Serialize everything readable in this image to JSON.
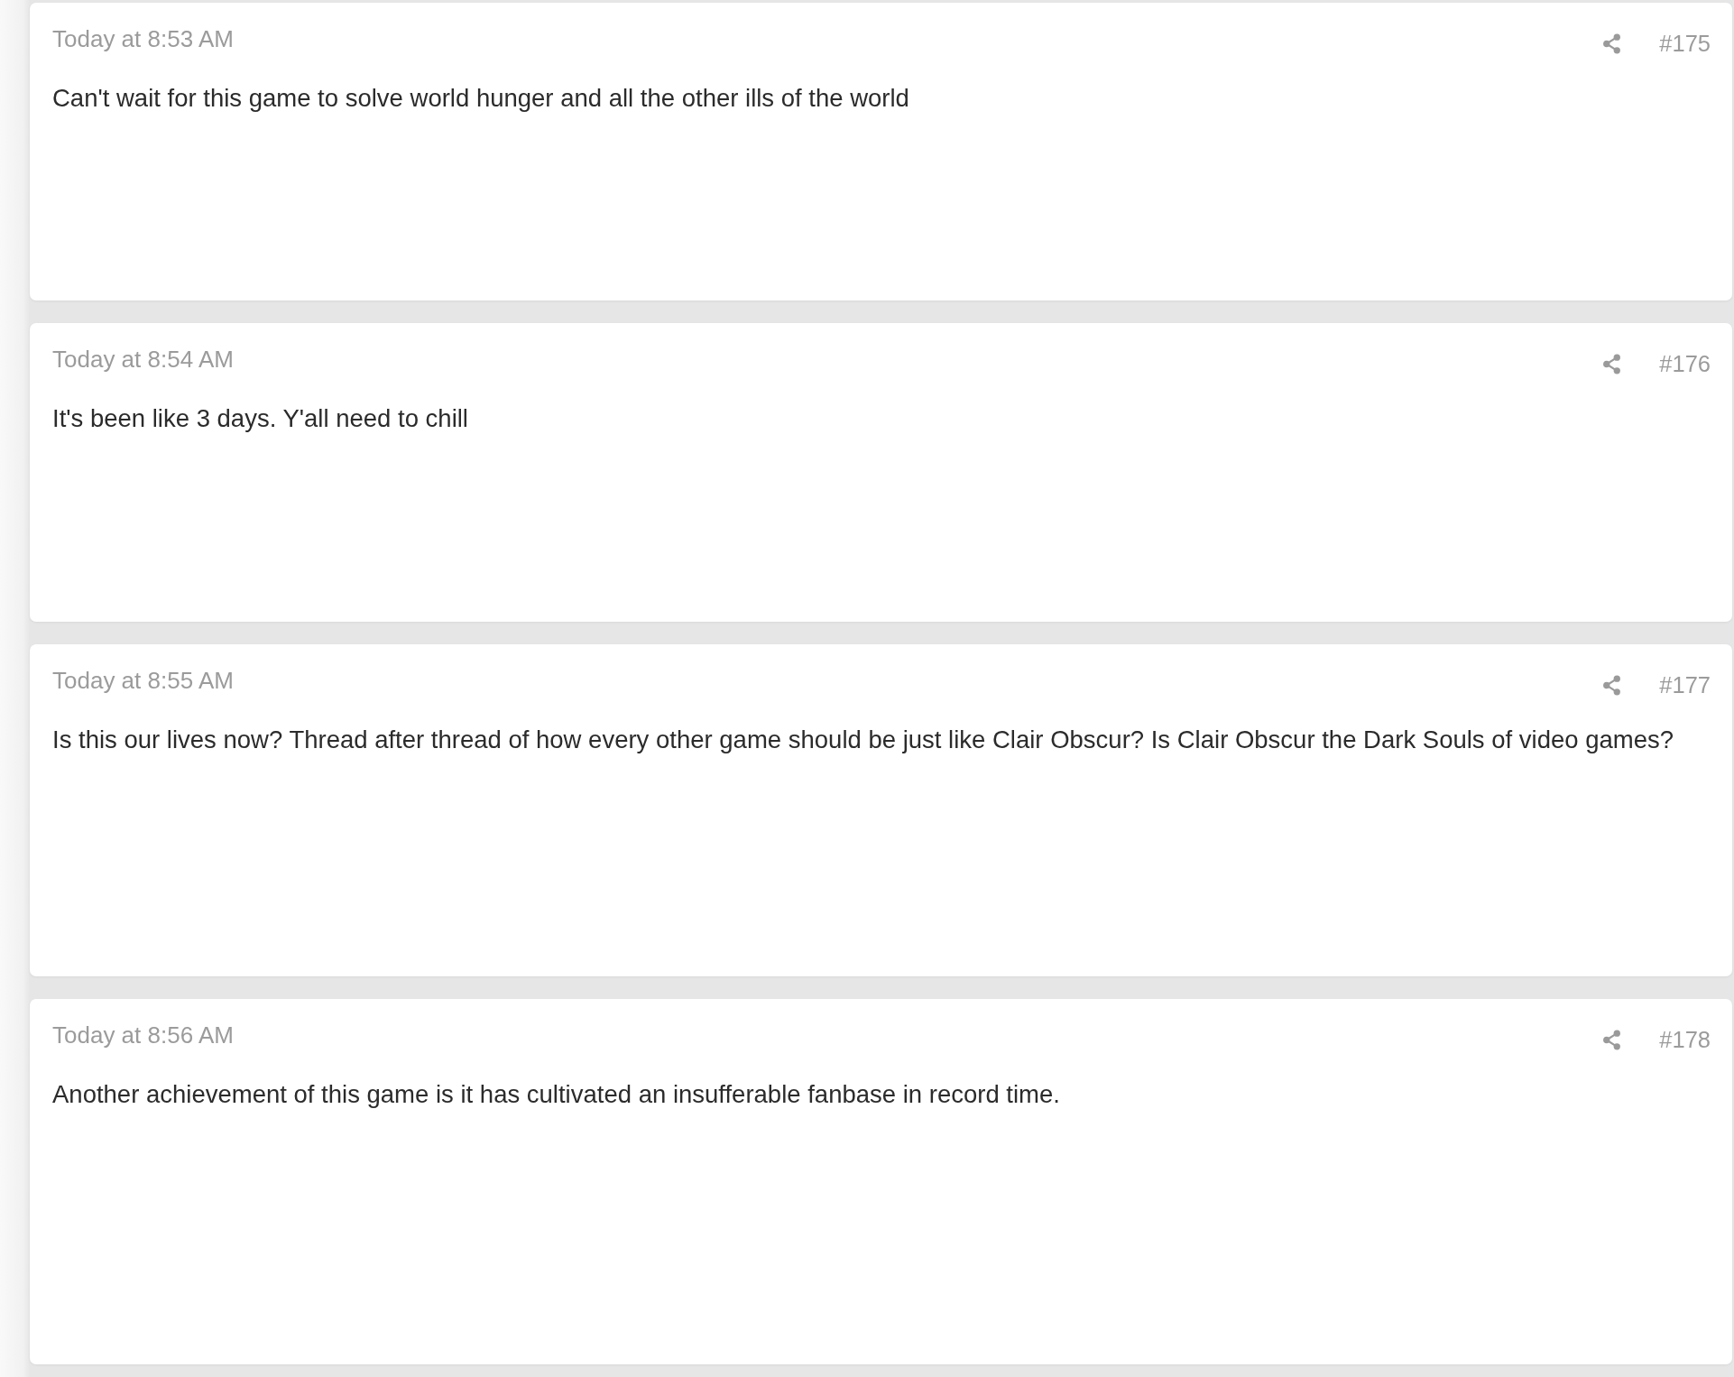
{
  "posts": [
    {
      "timestamp": "Today at 8:53 AM",
      "number": "#175",
      "text": "Can't wait for this game to solve world hunger and all the other ills of the world"
    },
    {
      "timestamp": "Today at 8:54 AM",
      "number": "#176",
      "text": "It's been like 3 days. Y'all need to chill"
    },
    {
      "timestamp": "Today at 8:55 AM",
      "number": "#177",
      "text": "Is this our lives now? Thread after thread of how every other game should be just like Clair Obscur? Is Clair Obscur the Dark Souls of video games?"
    },
    {
      "timestamp": "Today at 8:56 AM",
      "number": "#178",
      "text": "Another achievement of this game is it has cultivated an insufferable fanbase in record time."
    }
  ]
}
